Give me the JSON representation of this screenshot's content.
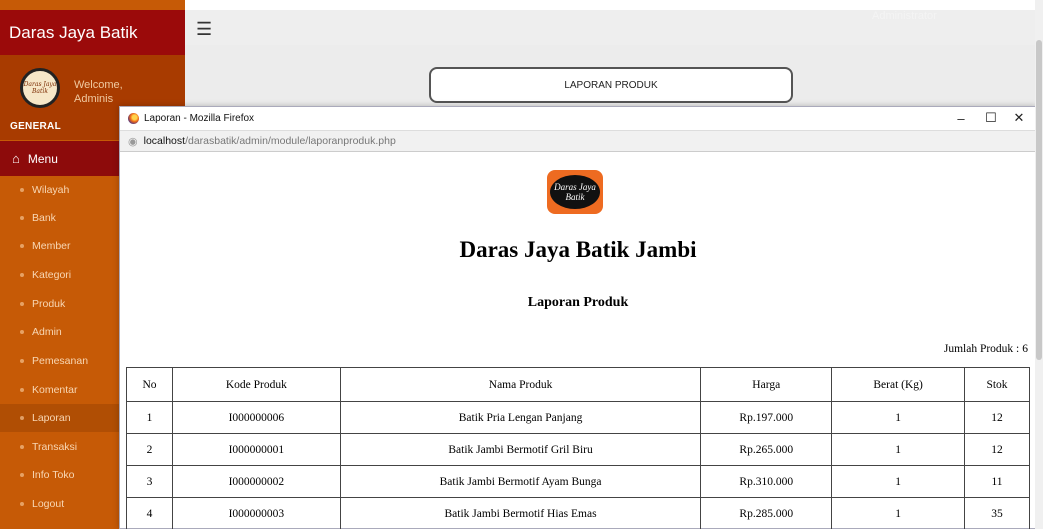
{
  "app": {
    "brand": "Daras Jaya Batik",
    "top_user": "Administrator",
    "welcome": "Welcome,",
    "welcome_user": "Adminis",
    "avatar_text": "Daras Jaya Batik",
    "section_label": "GENERAL",
    "menu_label": "Menu",
    "sidebar_items": [
      {
        "label": "Wilayah"
      },
      {
        "label": "Bank"
      },
      {
        "label": "Member"
      },
      {
        "label": "Kategori"
      },
      {
        "label": "Produk"
      },
      {
        "label": "Admin"
      },
      {
        "label": "Pemesanan"
      },
      {
        "label": "Komentar"
      },
      {
        "label": "Laporan"
      },
      {
        "label": "Transaksi"
      },
      {
        "label": "Info Toko"
      },
      {
        "label": "Logout"
      }
    ],
    "report_button": "LAPORAN PRODUK"
  },
  "popup": {
    "window_title": "Laporan - Mozilla Firefox",
    "url_host": "localhost",
    "url_path": "/darasbatik/admin/module/laporanproduk.php",
    "controls": {
      "minimize": "–",
      "maximize": "☐",
      "close": "✕"
    },
    "logo_text": "Daras Jaya Batik",
    "store_name": "Daras Jaya Batik Jambi",
    "report_title": "Laporan Produk",
    "count_label": "Jumlah Produk :",
    "count_value": "6",
    "table": {
      "headers": [
        "No",
        "Kode Produk",
        "Nama Produk",
        "Harga",
        "Berat (Kg)",
        "Stok"
      ],
      "rows": [
        [
          "1",
          "I000000006",
          "Batik Pria Lengan Panjang",
          "Rp.197.000",
          "1",
          "12"
        ],
        [
          "2",
          "I000000001",
          "Batik Jambi Bermotif Gril Biru",
          "Rp.265.000",
          "1",
          "12"
        ],
        [
          "3",
          "I000000002",
          "Batik Jambi Bermotif Ayam Bunga",
          "Rp.310.000",
          "1",
          "11"
        ],
        [
          "4",
          "I000000003",
          "Batik Jambi Bermotif Hias Emas",
          "Rp.285.000",
          "1",
          "35"
        ]
      ]
    }
  },
  "colors": {
    "sidebar": "#c65a06",
    "brand_bar": "#9b0a0a",
    "menu_head": "#8d0b0b",
    "logo_orange": "#ee6b21"
  }
}
